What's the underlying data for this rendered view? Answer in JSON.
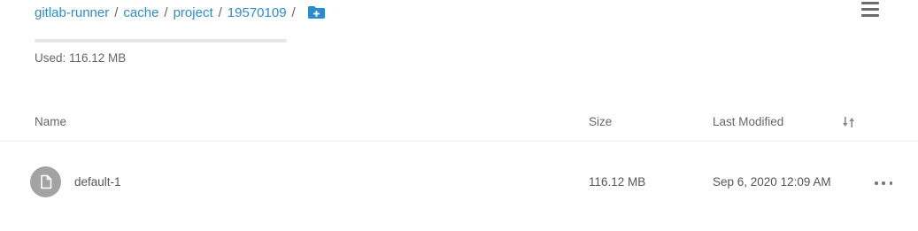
{
  "breadcrumb": {
    "items": [
      {
        "label": "gitlab-runner"
      },
      {
        "label": "cache"
      },
      {
        "label": "project"
      },
      {
        "label": "19570109"
      }
    ],
    "separator": "/",
    "add_folder_icon": "folder-plus-icon"
  },
  "menu_icon": "hamburger-menu-icon",
  "usage": {
    "text": "Used: 116.12 MB",
    "fill_fraction": 0.0
  },
  "table": {
    "headers": {
      "name": "Name",
      "size": "Size",
      "last_modified": "Last Modified"
    },
    "sort_icon": "sort-icon",
    "rows": [
      {
        "icon": "file-icon",
        "name": "default-1",
        "size": "116.12 MB",
        "last_modified": "Sep 6, 2020 12:09 AM",
        "actions_icon": "more-horizontal-icon"
      }
    ]
  },
  "colors": {
    "link": "#2b8bd0",
    "file_icon_bg": "#a3a3a3",
    "divider": "#eeeeee"
  }
}
